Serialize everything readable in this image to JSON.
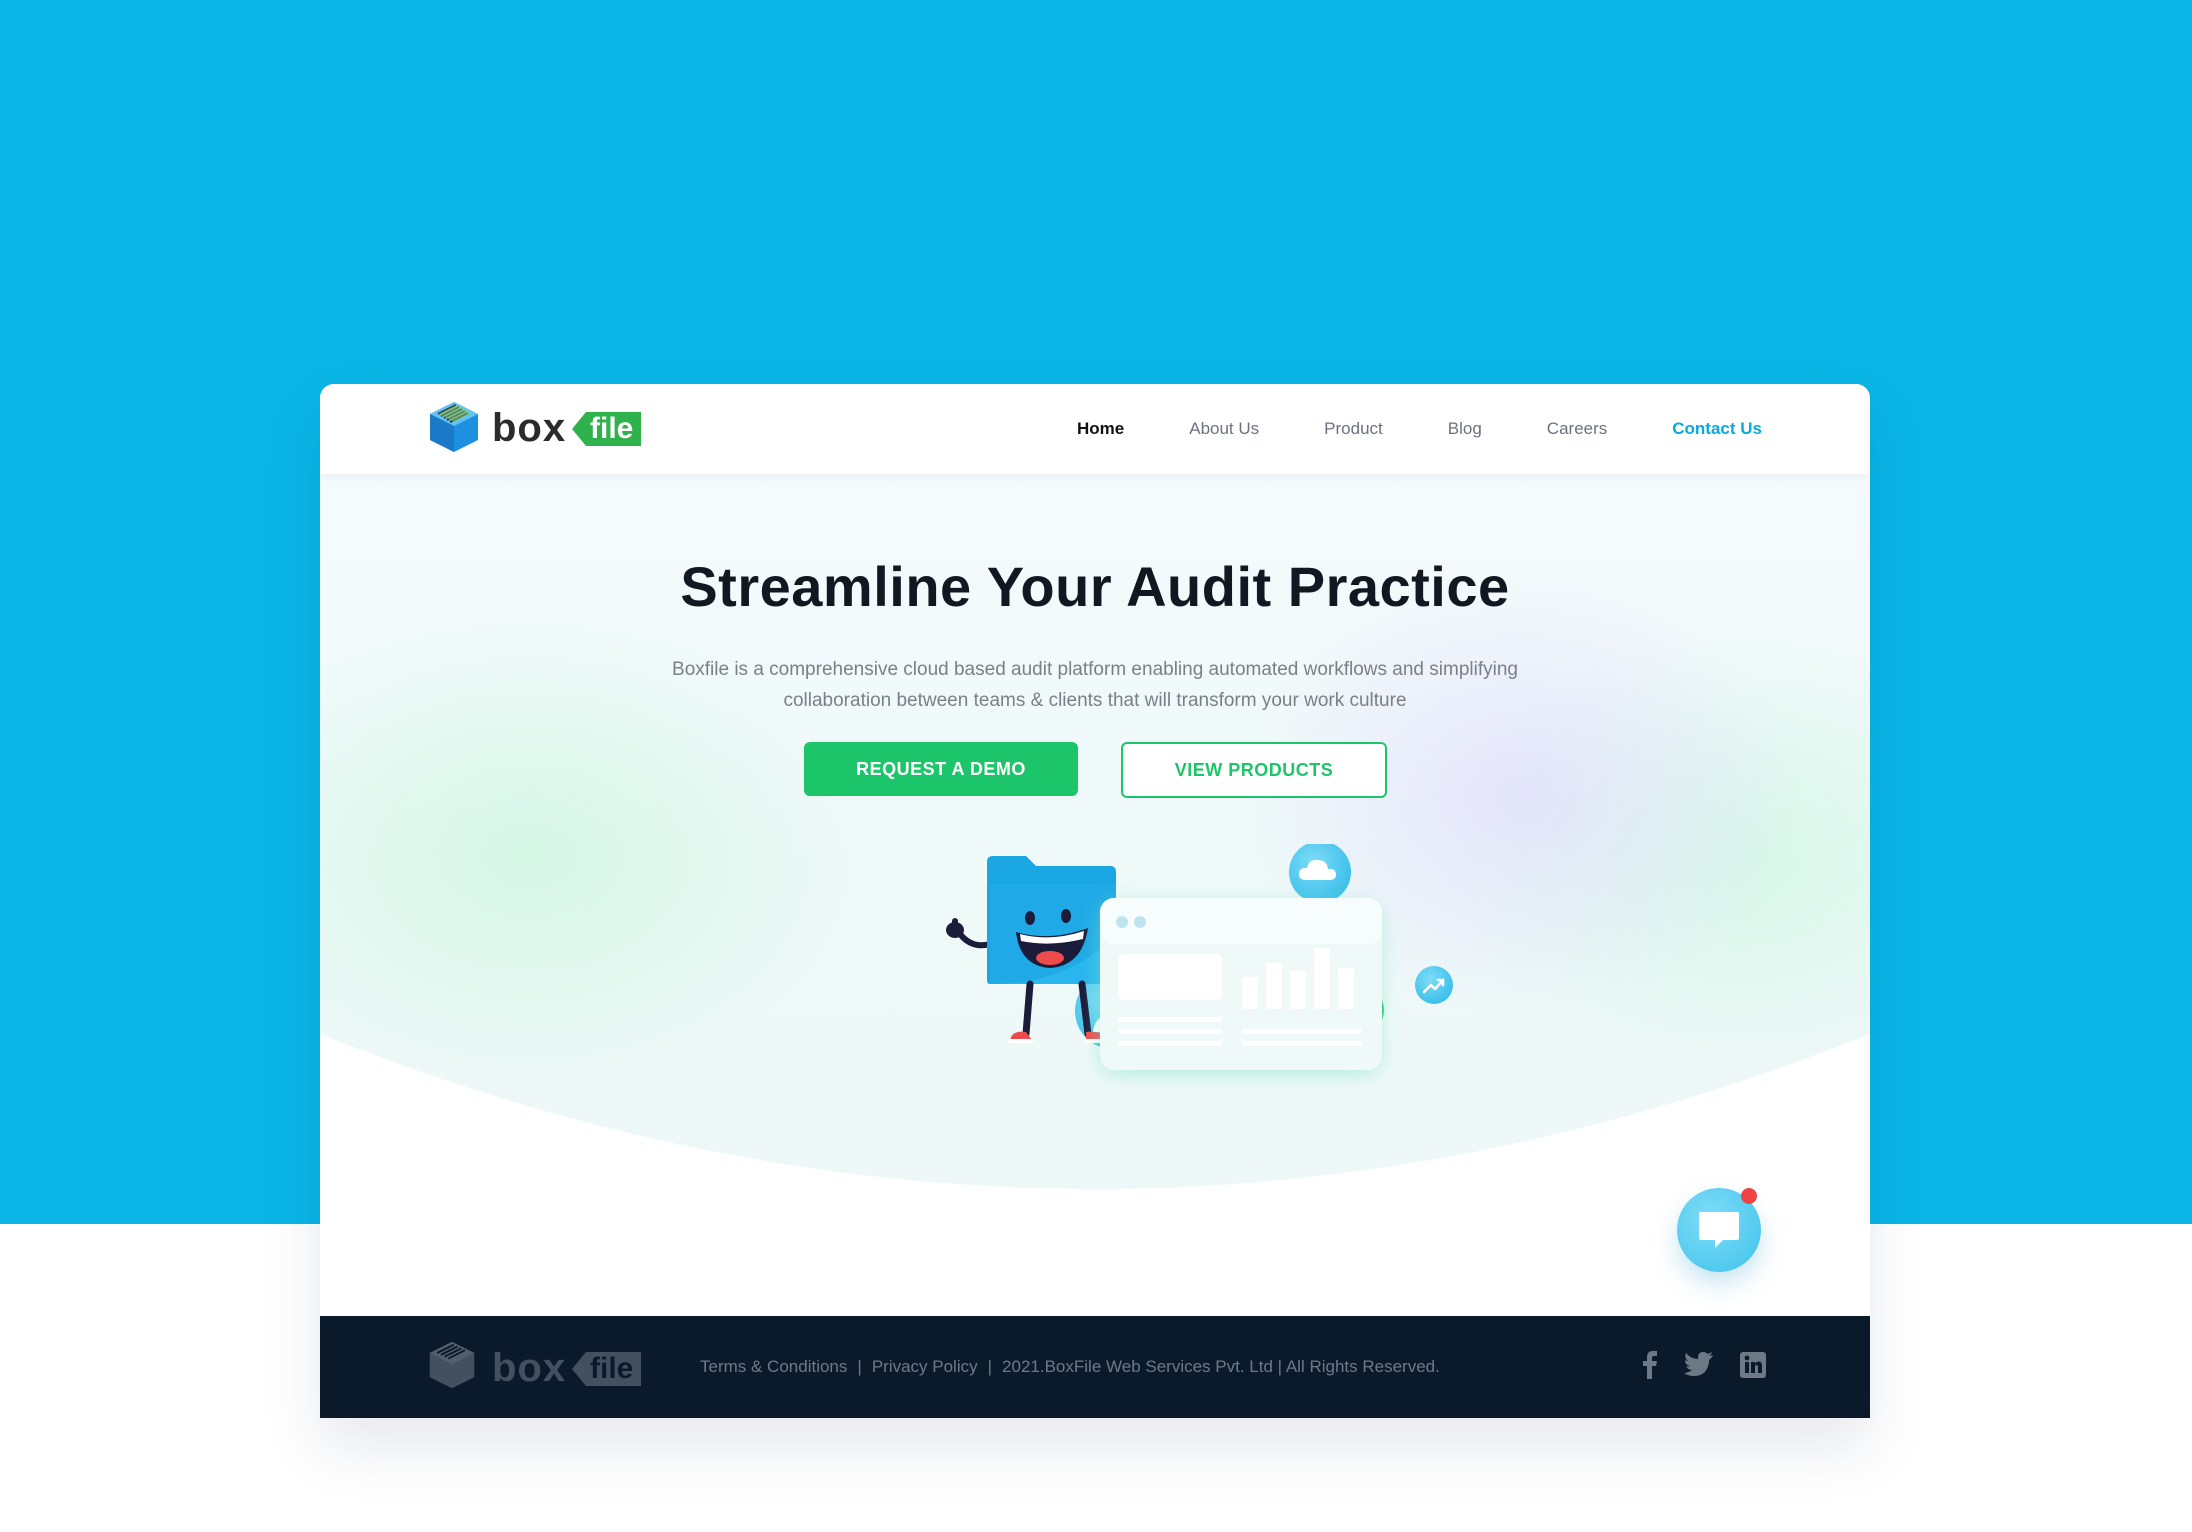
{
  "brand": {
    "word": "box",
    "tag": "file"
  },
  "nav": {
    "items": [
      {
        "label": "Home"
      },
      {
        "label": "About Us"
      },
      {
        "label": "Product"
      },
      {
        "label": "Blog"
      },
      {
        "label": "Careers"
      },
      {
        "label": "Contact Us"
      }
    ]
  },
  "hero": {
    "title": "Streamline Your Audit Practice",
    "subtitle_line1": "Boxfile is a comprehensive cloud based audit platform enabling automated workflows and simplifying",
    "subtitle_line2": "collaboration between teams & clients that will transform your work culture",
    "primary_cta": "REQUEST A DEMO",
    "secondary_cta": "VIEW PRODUCTS"
  },
  "illustration": {
    "icons": [
      "thumbs-up-icon",
      "user-icon",
      "cloud-icon",
      "shield-lock-icon",
      "trend-up-icon",
      "folder-mascot",
      "dashboard-card"
    ]
  },
  "chat": {
    "icon": "chat-bubble-icon",
    "has_notification": true
  },
  "footer": {
    "links": [
      "Terms & Conditions",
      "Privacy Policy"
    ],
    "copyright": "2021.BoxFile Web Services Pvt. Ltd | All Rights Reserved.",
    "social": [
      "facebook-icon",
      "twitter-icon",
      "linkedin-icon"
    ]
  },
  "colors": {
    "background": "#0ab5e6",
    "primary_green": "#1dc56a",
    "accent_blue": "#0aa9dd",
    "footer": "#0b1a2b",
    "notification": "#f04444"
  }
}
